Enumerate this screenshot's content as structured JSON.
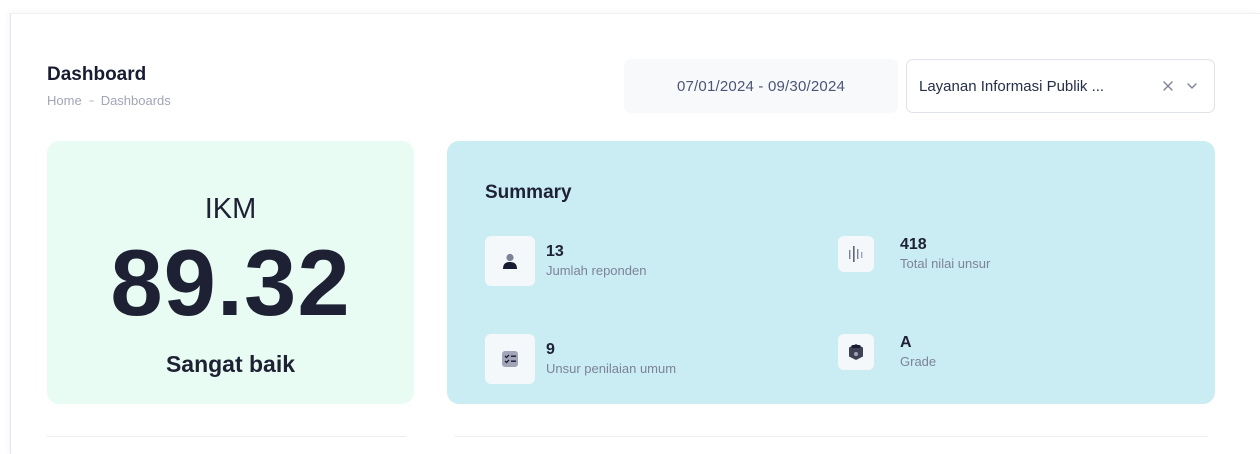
{
  "header": {
    "title": "Dashboard",
    "breadcrumb": [
      "Home",
      "Dashboards"
    ]
  },
  "filters": {
    "date_range": "07/01/2024 - 09/30/2024",
    "service": "Layanan Informasi Publik ..."
  },
  "ikm": {
    "label": "IKM",
    "value": "89.32",
    "category": "Sangat baik"
  },
  "summary": {
    "title": "Summary",
    "stats": [
      {
        "value": "13",
        "label": "Jumlah reponden",
        "icon": "user-icon"
      },
      {
        "value": "418",
        "label": "Total nilai unsur",
        "icon": "bars-icon"
      },
      {
        "value": "9",
        "label": "Unsur penilaian umum",
        "icon": "checklist-icon"
      },
      {
        "value": "A",
        "label": "Grade",
        "icon": "badge-icon"
      }
    ]
  },
  "colors": {
    "ikm_card": "#e8fcf4",
    "summary_card": "#c9edf2",
    "text_dark": "#1e2134",
    "text_muted": "#a1a5b7"
  }
}
